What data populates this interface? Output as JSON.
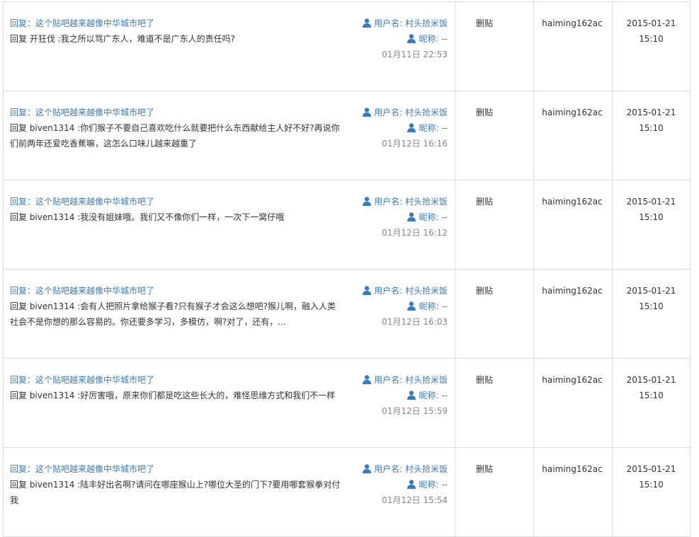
{
  "labels": {
    "username_prefix": "用户名: ",
    "nickname_prefix": "昵称: ",
    "delete_label": "删贴"
  },
  "colors": {
    "link": "#3a7bbf",
    "text": "#333333",
    "muted": "#888888",
    "border": "#dddddd"
  },
  "icons": {
    "user": "user-icon"
  },
  "posts": [
    {
      "title": "回复：这个贴吧越来越像中华城市吧了",
      "body": "回复 开狂伐 :我之所以骂广东人，难道不是广东人的责任吗?",
      "username": "村头拾米饭",
      "nickname": "--",
      "post_time": "01月11日 22:53",
      "operator": "haiming162ac",
      "op_date": "2015-01-21",
      "op_time": "15:10"
    },
    {
      "title": "回复：这个贴吧越来越像中华城市吧了",
      "body": "回复 biven1314 :你们猴子不要自己喜欢吃什么就要把什么东西献给主人好不好?再说你们前两年还爱吃香蕉嘛，这怎么口味儿越来越重了",
      "username": "村头拾米饭",
      "nickname": "--",
      "post_time": "01月12日 16:16",
      "operator": "haiming162ac",
      "op_date": "2015-01-21",
      "op_time": "15:10"
    },
    {
      "title": "回复：这个贴吧越来越像中华城市吧了",
      "body": "回复 biven1314 :我没有姐妹哦。我们又不像你们一样，一次下一窝仔哦",
      "username": "村头拾米饭",
      "nickname": "--",
      "post_time": "01月12日 16:12",
      "operator": "haiming162ac",
      "op_date": "2015-01-21",
      "op_time": "15:10"
    },
    {
      "title": "回复：这个贴吧越来越像中华城市吧了",
      "body": "回复 biven1314 :会有人把照片拿给猴子看?只有猴子才会这么想吧?猴儿啊，融入人类社会不是你想的那么容易的。你还要多学习，多模仿，啊?对了，还有，...",
      "username": "村头拾米饭",
      "nickname": "--",
      "post_time": "01月12日 16:03",
      "operator": "haiming162ac",
      "op_date": "2015-01-21",
      "op_time": "15:10"
    },
    {
      "title": "回复：这个贴吧越来越像中华城市吧了",
      "body": "回复 biven1314 :好厉害哦，原来你们都是吃这些长大的，难怪思维方式和我们不一样",
      "username": "村头拾米饭",
      "nickname": "--",
      "post_time": "01月12日 15:59",
      "operator": "haiming162ac",
      "op_date": "2015-01-21",
      "op_time": "15:10"
    },
    {
      "title": "回复：这个贴吧越来越像中华城市吧了",
      "body": "回复 biven1314 :陆丰好出名啊?请问在哪座猴山上?哪位大圣的门下?要用哪套猴拳对付我",
      "username": "村头拾米饭",
      "nickname": "--",
      "post_time": "01月12日 15:54",
      "operator": "haiming162ac",
      "op_date": "2015-01-21",
      "op_time": "15:10"
    }
  ]
}
